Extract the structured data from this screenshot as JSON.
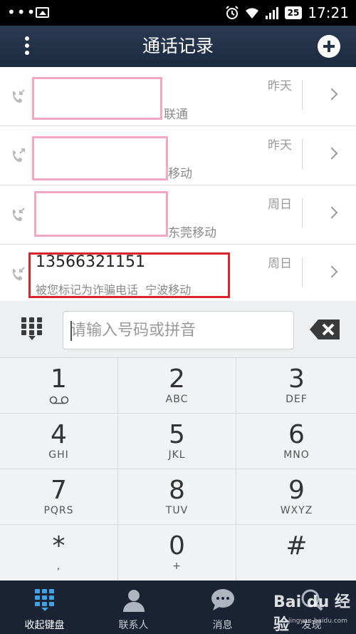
{
  "status_bar": {
    "dots": "•••",
    "battery": "25",
    "time": "17:21"
  },
  "header": {
    "title": "通话记录"
  },
  "calls": [
    {
      "type": "incoming",
      "location": "联通",
      "date": "昨天"
    },
    {
      "type": "outgoing",
      "location": "移动",
      "date": "昨天"
    },
    {
      "type": "incoming",
      "location": "东莞移动",
      "date": "周日"
    },
    {
      "type": "incoming",
      "number": "13566321151",
      "tag": "被您标记为诈骗电话",
      "location": "宁波移动",
      "date": "周日"
    }
  ],
  "dialer": {
    "placeholder": "请输入号码或拼音",
    "keys": [
      {
        "digit": "1",
        "letters": ""
      },
      {
        "digit": "2",
        "letters": "ABC"
      },
      {
        "digit": "3",
        "letters": "DEF"
      },
      {
        "digit": "4",
        "letters": "GHI"
      },
      {
        "digit": "5",
        "letters": "JKL"
      },
      {
        "digit": "6",
        "letters": "MNO"
      },
      {
        "digit": "7",
        "letters": "PQRS"
      },
      {
        "digit": "8",
        "letters": "TUV"
      },
      {
        "digit": "9",
        "letters": "WXYZ"
      },
      {
        "digit": "*",
        "letters": ","
      },
      {
        "digit": "0",
        "letters": "+"
      },
      {
        "digit": "#",
        "letters": ""
      }
    ]
  },
  "bottom_nav": {
    "tabs": [
      {
        "label": "收起键盘",
        "icon": "keypad-icon",
        "active": true
      },
      {
        "label": "联系人",
        "icon": "contacts-icon",
        "active": false
      },
      {
        "label": "消息",
        "icon": "message-icon",
        "active": false
      },
      {
        "label": "发现",
        "icon": "discover-icon",
        "active": false
      }
    ]
  },
  "watermark": {
    "brand": "Bai du 经验",
    "url": "jingyan.baidu.com"
  },
  "colors": {
    "header_bg": "#24344c",
    "nav_bg": "#1a2233",
    "accent_blue": "#3fa3e6",
    "highlight_red": "#d9242b",
    "redact_pink": "#f4a6c5"
  }
}
